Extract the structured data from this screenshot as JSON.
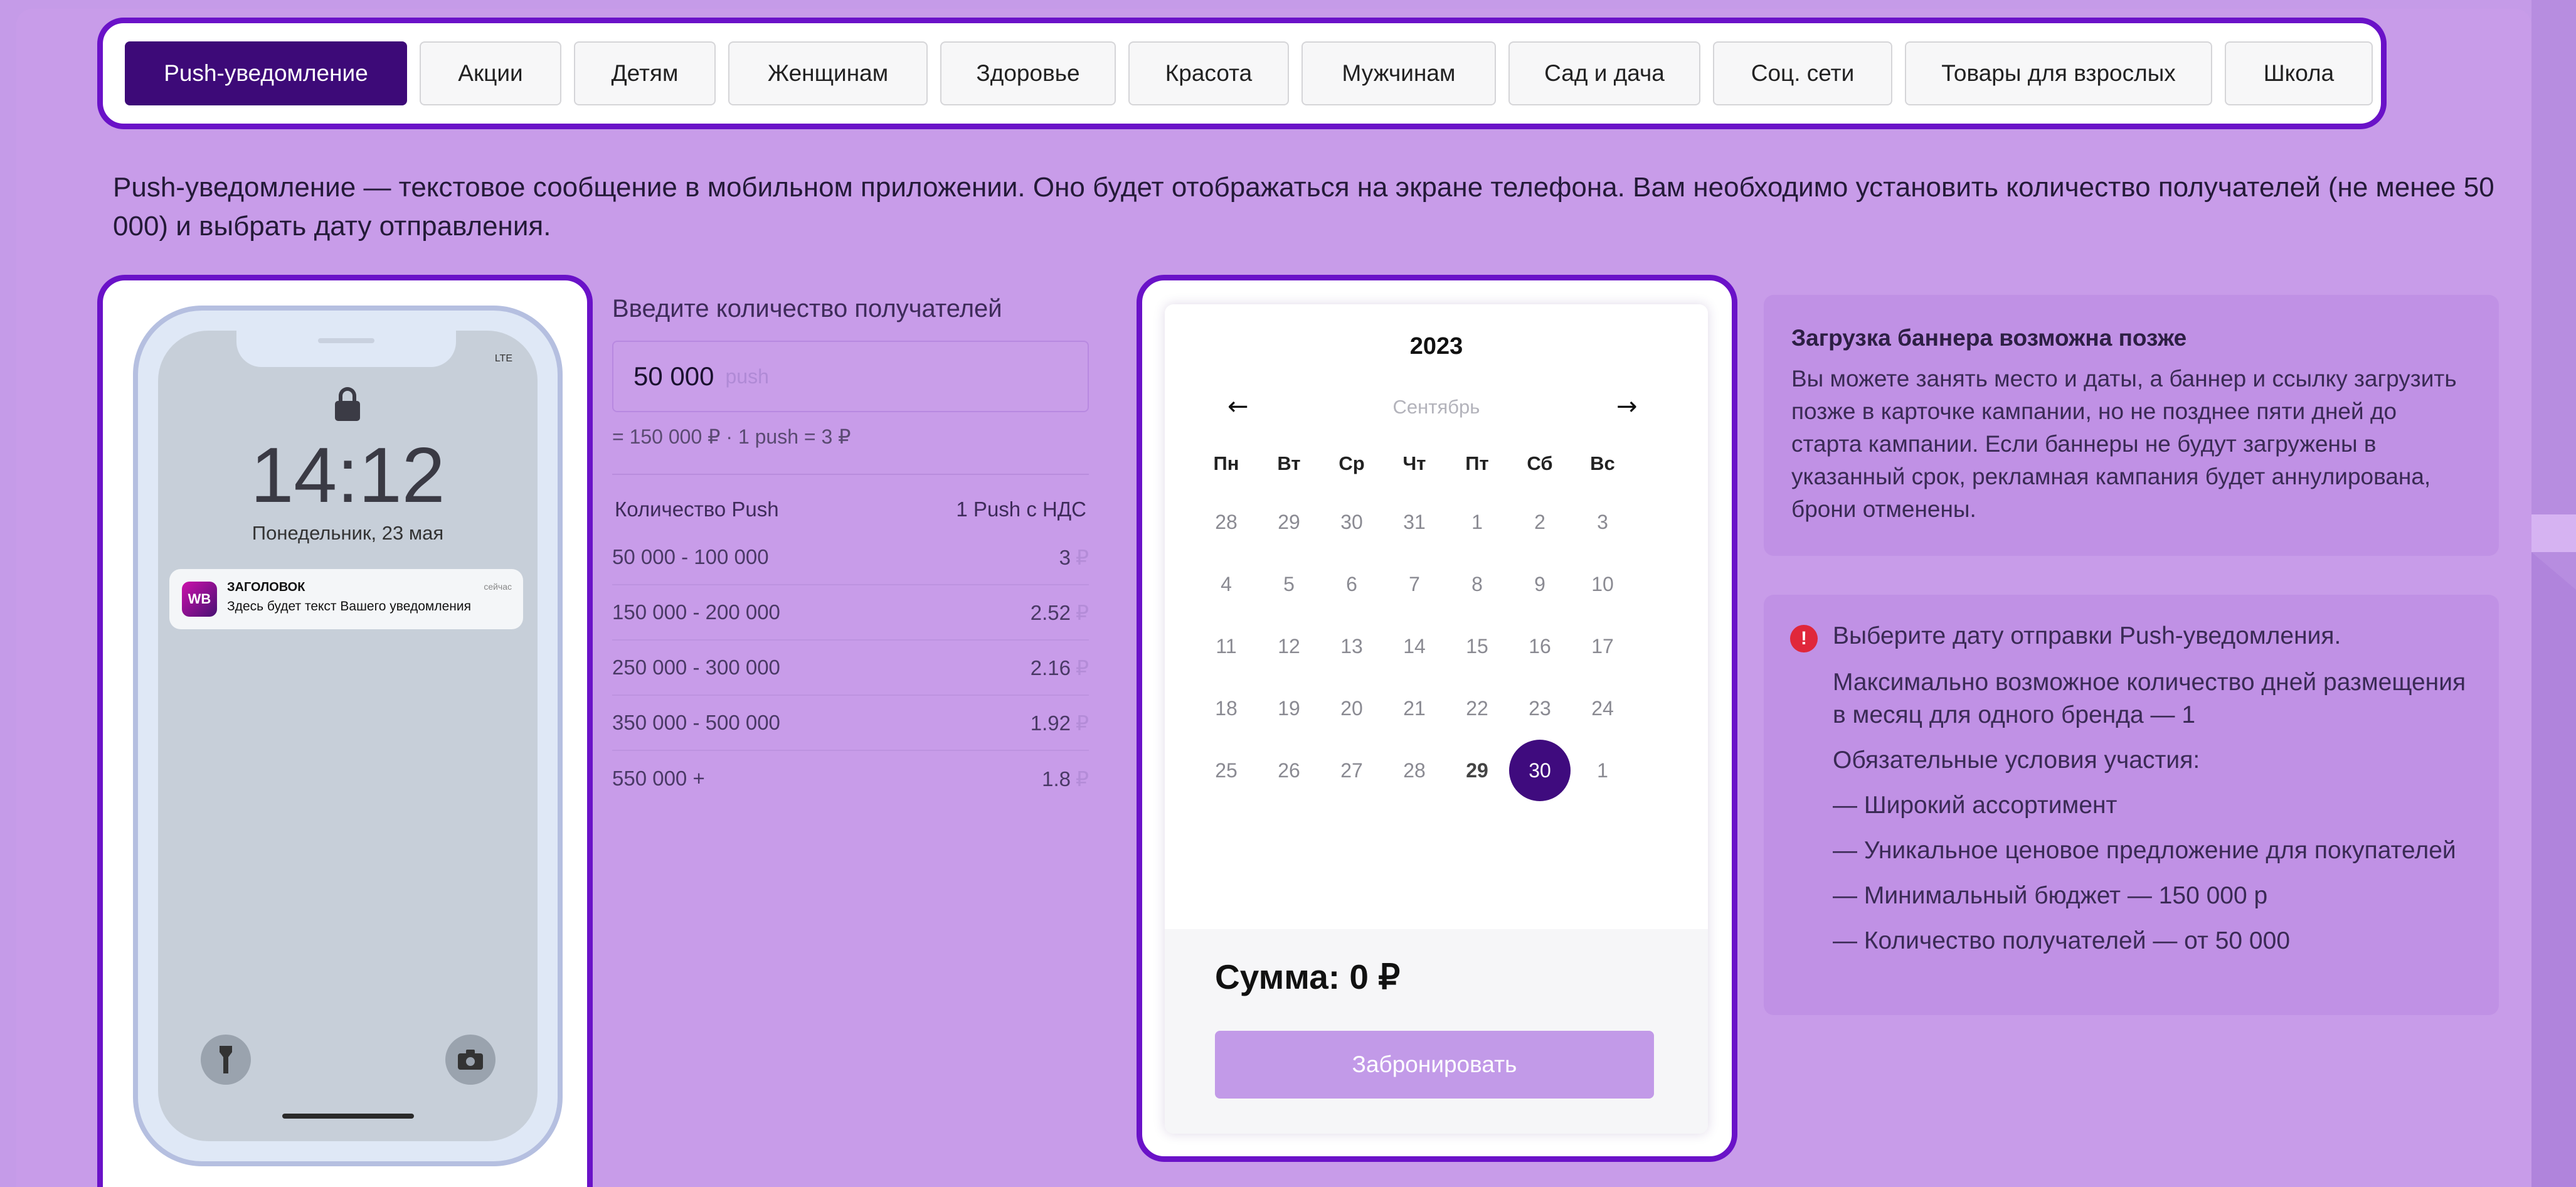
{
  "tabs": [
    {
      "label": "Push-уведомление",
      "active": true
    },
    {
      "label": "Акции"
    },
    {
      "label": "Детям"
    },
    {
      "label": "Женщинам"
    },
    {
      "label": "Здоровье"
    },
    {
      "label": "Красота"
    },
    {
      "label": "Мужчинам"
    },
    {
      "label": "Сад и дача"
    },
    {
      "label": "Соц. сети"
    },
    {
      "label": "Товары для взрослых"
    },
    {
      "label": "Школа"
    }
  ],
  "intro": "Push-уведомление — текстовое сообщение в мобильном приложении. Оно будет отображаться на экране телефона. Вам необходимо установить количество получателей (не менее 50 000) и выбрать дату отправления.",
  "phone": {
    "status": "LTE",
    "time": "14:12",
    "date": "Понедельник, 23 мая",
    "notification": {
      "app_badge": "WB",
      "title": "ЗАГОЛОВОК",
      "when": "сейчас",
      "text": "Здесь будет текст Вашего уведомления"
    }
  },
  "recipients": {
    "label": "Введите количество получателей",
    "value": "50 000",
    "unit": "push",
    "calc": "= 150 000 ₽  ·  1 push = 3 ₽",
    "table_header": {
      "qty": "Количество Push",
      "price": "1 Push с НДС"
    },
    "rows": [
      {
        "qty": "50 000 - 100 000",
        "price": "3",
        "cur": "₽"
      },
      {
        "qty": "150 000 - 200 000",
        "price": "2.52",
        "cur": "₽"
      },
      {
        "qty": "250 000 - 300 000",
        "price": "2.16",
        "cur": "₽"
      },
      {
        "qty": "350 000 - 500 000",
        "price": "1.92",
        "cur": "₽"
      },
      {
        "qty": "550 000 +",
        "price": "1.8",
        "cur": "₽"
      }
    ]
  },
  "calendar": {
    "year": "2023",
    "month": "Сентябрь",
    "prev_icon": "←",
    "next_icon": "→",
    "weekdays": [
      "Пн",
      "Вт",
      "Ср",
      "Чт",
      "Пт",
      "Сб",
      "Вс"
    ],
    "weeks": [
      [
        "28",
        "29",
        "30",
        "31",
        "1",
        "2",
        "3"
      ],
      [
        "4",
        "5",
        "6",
        "7",
        "8",
        "9",
        "10"
      ],
      [
        "11",
        "12",
        "13",
        "14",
        "15",
        "16",
        "17"
      ],
      [
        "18",
        "19",
        "20",
        "21",
        "22",
        "23",
        "24"
      ],
      [
        "25",
        "26",
        "27",
        "28",
        "29",
        "30",
        "1"
      ]
    ],
    "bold_day": "29",
    "selected_day": "30",
    "sum": "Сумма: 0 ₽",
    "book_label": "Забронировать"
  },
  "info_banner": {
    "title": "Загрузка баннера возможна позже",
    "text": "Вы можете занять место и даты, а баннер и ссылку загрузить позже в карточке кампании, но не позднее пяти дней до старта кампании. Если баннеры не будут загружены в указанный срок, рекламная кампания будет аннулирована, брони отменены."
  },
  "info_rules": {
    "icon": "!",
    "lines": [
      "Выберите дату отправки Push-уведомления.",
      "Максимально возможное количество дней размещения в месяц для одного бренда — 1",
      "Обязательные условия участия:",
      "— Широкий ассортимент",
      "— Уникальное ценовое предложение для покупателей",
      "— Минимальный бюджет — 150 000 р",
      "— Количество получателей — от 50 000"
    ]
  }
}
